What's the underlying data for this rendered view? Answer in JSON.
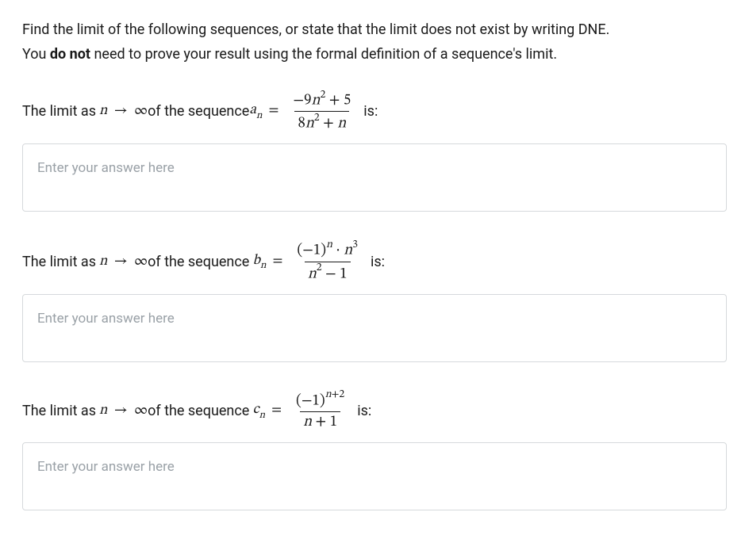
{
  "instructions": {
    "line1_pre": "Find the limit of the following sequences, or state that the limit does not exist by writing DNE.",
    "line2_pre": "You ",
    "line2_bold": "do not",
    "line2_post": " need to prove your result using the formal definition of a sequence's limit."
  },
  "questions": [
    {
      "lead": "The limit as ",
      "seq_letter": "a",
      "sub": "n",
      "frac_num": "−9n² + 5",
      "frac_den": "8n² + n",
      "is": " is:",
      "placeholder": "Enter your answer here"
    },
    {
      "lead": "The limit as ",
      "seq_letter": "b",
      "sub": "n",
      "frac_num": "(−1)ⁿ · n³",
      "frac_den": "n² − 1",
      "is": " is:",
      "placeholder": "Enter your answer here"
    },
    {
      "lead": "The limit as ",
      "seq_letter": "c",
      "sub": "n",
      "frac_num": "(−1)ⁿ⁺²",
      "frac_den": "n + 1",
      "is": " is:",
      "placeholder": "Enter your answer here"
    }
  ],
  "math_common": {
    "n_to_inf_n": "n",
    "arrow": "→",
    "infty": "∞",
    "of_sequence": " of the sequence ",
    "equals": "="
  }
}
